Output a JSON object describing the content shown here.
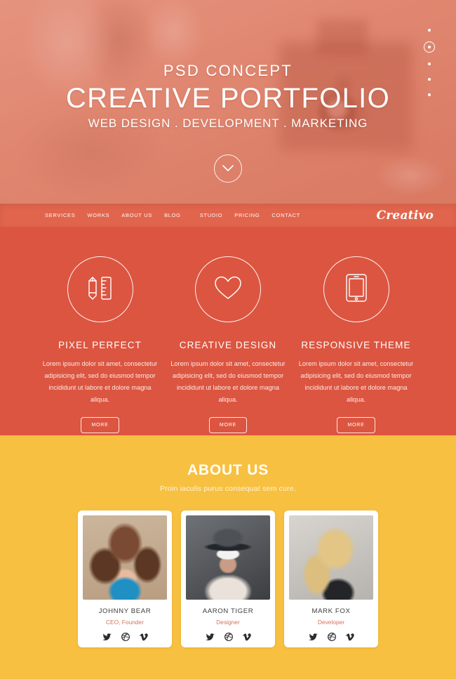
{
  "hero": {
    "eyebrow": "PSD CONCEPT",
    "title": "CREATIVE PORTFOLIO",
    "subtitle": "WEB DESIGN . DEVELOPMENT . MARKETING",
    "scroll_icon": "chevron-down-icon",
    "slider_dots": 5,
    "active_dot": 2,
    "background_color": "#e2957f"
  },
  "nav": {
    "brand": "Creativo",
    "items": [
      {
        "label": "SERVICES"
      },
      {
        "label": "WORKS"
      },
      {
        "label": "ABOUT US"
      },
      {
        "label": "BLOG"
      },
      {
        "label": "STUDIO"
      },
      {
        "label": "PRICING"
      },
      {
        "label": "CONTACT"
      }
    ],
    "background_color": "#e1654d"
  },
  "services": {
    "background_color": "#dc5540",
    "cards": [
      {
        "icon": "pencil-ruler-icon",
        "title": "PIXEL PERFECT",
        "text": "Lorem ipsum dolor sit amet, consectetur adipisicing elit, sed do eiusmod tempor incididunt ut labore et dolore magna aliqua.",
        "button": "MORE"
      },
      {
        "icon": "heart-icon",
        "title": "CREATIVE DESIGN",
        "text": "Lorem ipsum dolor sit amet, consectetur adipisicing elit, sed do eiusmod tempor incididunt ut labore et dolore magna aliqua.",
        "button": "MORE"
      },
      {
        "icon": "tablet-icon",
        "title": "RESPONSIVE THEME",
        "text": "Lorem ipsum dolor sit amet, consectetur adipisicing elit, sed do eiusmod tempor incididunt ut labore et dolore magna aliqua.",
        "button": "MORE"
      }
    ]
  },
  "about": {
    "background_color": "#f8c040",
    "title": "ABOUT US",
    "subtitle": "Proin iaculis purus consequat sem cure.",
    "role_color": "#d9715c",
    "team": [
      {
        "name": "JOHNNY BEAR",
        "role": "CEO, Founder",
        "photo": "portrait-woman-brunette",
        "social": [
          "twitter-icon",
          "dribbble-icon",
          "vimeo-icon"
        ]
      },
      {
        "name": "AARON TIGER",
        "role": "Designer",
        "photo": "portrait-man-hat-sunglasses",
        "social": [
          "twitter-icon",
          "dribbble-icon",
          "vimeo-icon"
        ]
      },
      {
        "name": "MARK FOX",
        "role": "Developer",
        "photo": "portrait-woman-blonde",
        "social": [
          "twitter-icon",
          "dribbble-icon",
          "vimeo-icon"
        ]
      }
    ]
  }
}
